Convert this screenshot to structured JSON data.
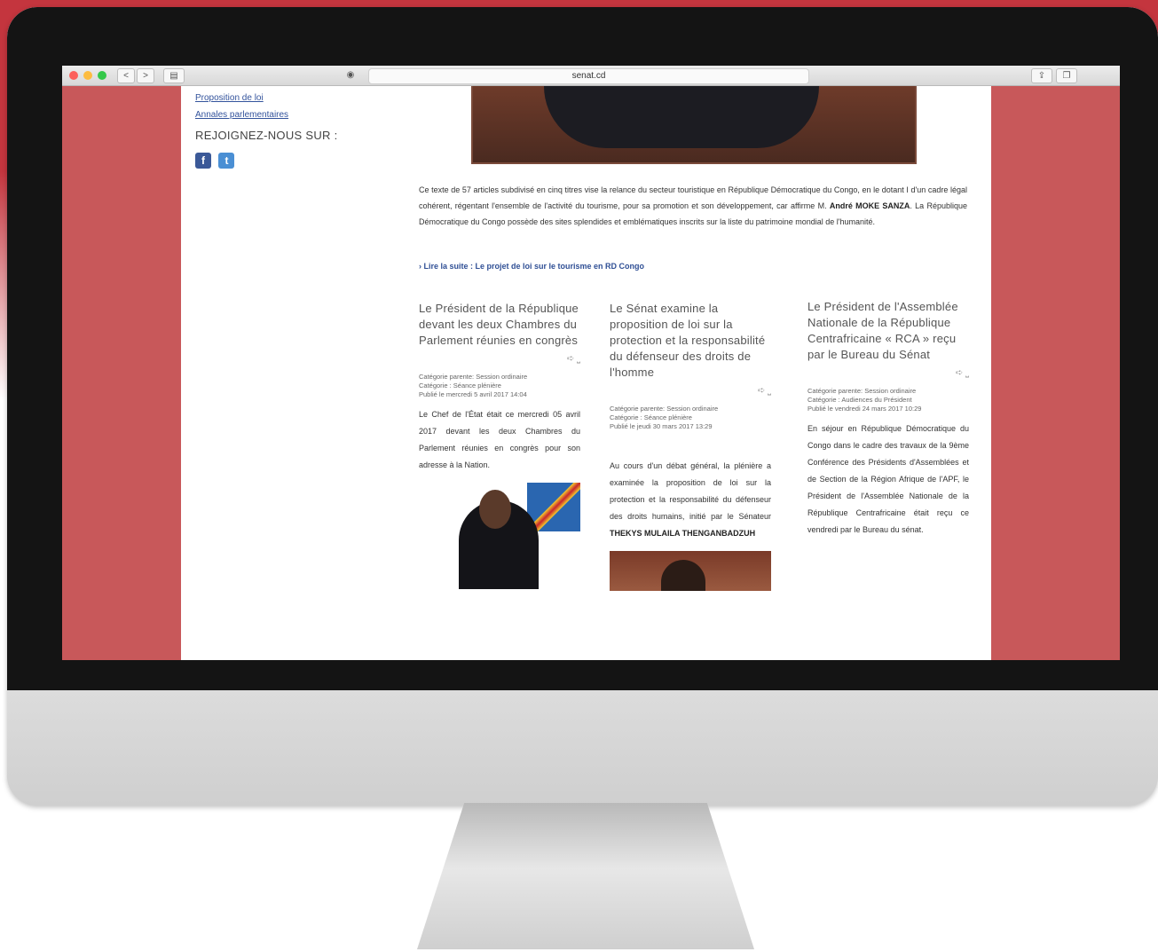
{
  "browser": {
    "url": "senat.cd",
    "nav_back": "<",
    "nav_forward": ">"
  },
  "sidebar": {
    "links": [
      "Proposition de loi",
      "Annales parlementaires"
    ],
    "join_title": "REJOIGNEZ-NOUS SUR :",
    "social": [
      "facebook-icon",
      "twitter-icon"
    ]
  },
  "article": {
    "intro_part1": "Ce texte de 57 articles subdivisé en cinq titres vise la relance du secteur touristique en République Démocratique du Congo, en le dotant I d'un cadre légal cohérent, régentant l'ensemble de l'activité du tourisme, pour sa promotion et son développement, car affirme M. ",
    "intro_name": "André MOKE SANZA",
    "intro_part2": ". La République Démocratique du Congo  possède des sites splendides et emblématiques inscrits sur la liste du patrimoine mondial de l'humanité.",
    "read_more": "› Lire la suite : Le projet de loi sur le tourisme en RD Congo"
  },
  "columns": [
    {
      "title": "Le Président de la République devant les deux Chambres du Parlement réunies en congrès",
      "meta_parent": "Catégorie parente: Session ordinaire",
      "meta_category": "Catégorie : Séance plénière",
      "meta_published": "Publié le mercredi 5 avril 2017 14:04",
      "body": "Le Chef de l'État était ce mercredi 05 avril 2017 devant les deux Chambres du Parlement réunies en congrès pour son adresse à la Nation."
    },
    {
      "title": "Le Sénat examine la proposition de loi sur la protection et la responsabilité du défenseur des droits de l'homme",
      "meta_parent": "Catégorie parente: Session ordinaire",
      "meta_category": "Catégorie : Séance plénière",
      "meta_published": "Publié le jeudi 30 mars 2017 13:29",
      "body": "Au cours d'un débat général, la plénière a examinée la proposition de loi sur la protection et la responsabilité du défenseur des droits humains, initié par le Sénateur ",
      "body_bold": "THEKYS MULAILA THENGANBADZUH"
    },
    {
      "title": "Le Président de l'Assemblée Nationale de la République Centrafricaine « RCA » reçu par le Bureau du Sénat",
      "meta_parent": "Catégorie parente: Session ordinaire",
      "meta_category": "Catégorie : Audiences du Président",
      "meta_published": "Publié le vendredi 24 mars 2017 10:29",
      "body": "En séjour en République Démocratique du Congo dans le cadre des travaux de la 9ème Conférence des Présidents d'Assemblées et de Section de la Région Afrique de l'APF, le Président de l'Assemblée Nationale de la République Centrafricaine était reçu ce vendredi par le Bureau du sénat."
    }
  ],
  "colors": {
    "page_background": "#c8585a",
    "link": "#33539c",
    "facebook": "#3b5998",
    "twitter": "#4a8fd4"
  }
}
